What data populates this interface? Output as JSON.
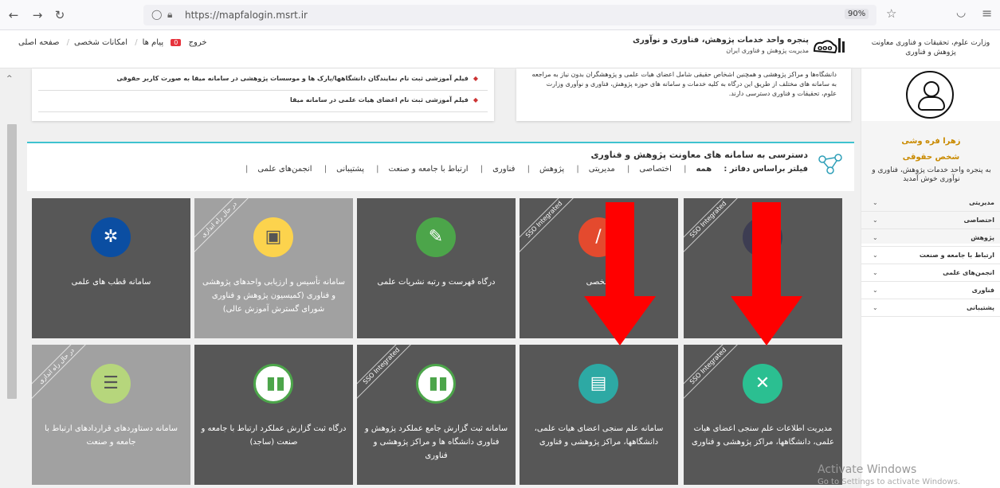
{
  "browser": {
    "url": "https://mapfalogin.msrt.ir",
    "zoom": "90%"
  },
  "header": {
    "ministry": "وزارت علوم، تحقیقات و فناوری معاونت پژوهش و فناوری",
    "portal_title": "پنجره واحد خدمات پژوهش، فناوری و نوآوری",
    "portal_subtitle": "مدیریت پژوهش و فناوری ایران",
    "links": {
      "home": "صفحه اصلی",
      "personal": "امکانات شخصی",
      "messages": "پیام ها",
      "messages_count": "0",
      "logout": "خروج"
    }
  },
  "sidebar": {
    "user_name": "زهرا فره وشی",
    "user_type": "شخص حقوقی",
    "welcome": "به پنجره واحد خدمات پژوهش، فناوری و نوآوری خوش آمدید",
    "menu": [
      "مدیریتی",
      "اختصاصی",
      "پژوهش",
      "ارتباط با جامعه و صنعت",
      "انجمن‌های علمی",
      "فناوری",
      "پشتیبانی"
    ]
  },
  "intro": {
    "text": "دانشگاه‌ها و مراکز پژوهشی و همچنین اشخاص حقیقی شامل اعضای هیات علمی و پژوهشگران بدون نیاز به مراجعه به سامانه های مختلف از طریق این درگاه به کلیه خدمات و سامانه های حوزه پژوهش، فناوری و نوآوری وزارت علوم، تحقیقات و فناوری دسترسی دارند."
  },
  "films": [
    "فیلم آموزشی ثبت نام نمایندگان دانشگاهها/پارک ها و موسسات پژوهشی در سامانه میقا به صورت کاربر حقوقی",
    "فیلم آموزشی ثبت نام اعضای هیات علمی در سامانه میقا"
  ],
  "filter": {
    "title": "دسترسی به سامانه های معاونت پژوهش و فناوری",
    "label": "فیلتر براساس دفاتر :",
    "options": [
      "همه",
      "اختصاصی",
      "مدیریتی",
      "پژوهش",
      "فناوری",
      "ارتباط با جامعه و صنعت",
      "پشتیبانی",
      "انجمن‌های علمی"
    ]
  },
  "tiles_row1": [
    {
      "title": "سامانه قطب های علمی",
      "ribbon": ""
    },
    {
      "title": "سامانه تأسیس و ارزیابی واحدهای پژوهشی و فناوری (کمیسیون پژوهش و فناوری شورای گسترش آموزش عالی)",
      "ribbon": "در حال راه اندازی"
    },
    {
      "title": "درگاه فهرست و رتبه نشریات علمی",
      "ribbon": ""
    },
    {
      "title": "شخصی",
      "ribbon": "SSO Integrated"
    },
    {
      "title": "م ن",
      "ribbon": "SSO Integrated"
    }
  ],
  "tiles_row2": [
    {
      "title": "سامانه دستاوردهای قراردادهای ارتباط با جامعه و صنعت",
      "ribbon": "در حال راه اندازی"
    },
    {
      "title": "درگاه ثبت گزارش عملکرد ارتباط با جامعه و صنعت (ساجد)",
      "ribbon": ""
    },
    {
      "title": "سامانه ثبت گزارش جامع عملکرد پژوهش و فناوری دانشگاه ها و مراکز پژوهشی و فناوری",
      "ribbon": "SSO Integrated"
    },
    {
      "title": "سامانه علم سنجی اعضای هیات علمی، دانشگاهها، مراکز پژوهشی و فناوری",
      "ribbon": ""
    },
    {
      "title": "مدیریت اطلاعات علم سنجی اعضای هیات علمی، دانشگاهها، مراکز پژوهشی و فناوری",
      "ribbon": "SSO Integrated"
    }
  ],
  "watermark": {
    "line1": "Activate Windows",
    "line2": "Go to Settings to activate Windows."
  },
  "colors": {
    "accent": "#3ec2cf",
    "tile_dark": "#575757",
    "tile_light": "#a1a1a1",
    "arrow": "#ff0000",
    "user": "#c98a00"
  }
}
